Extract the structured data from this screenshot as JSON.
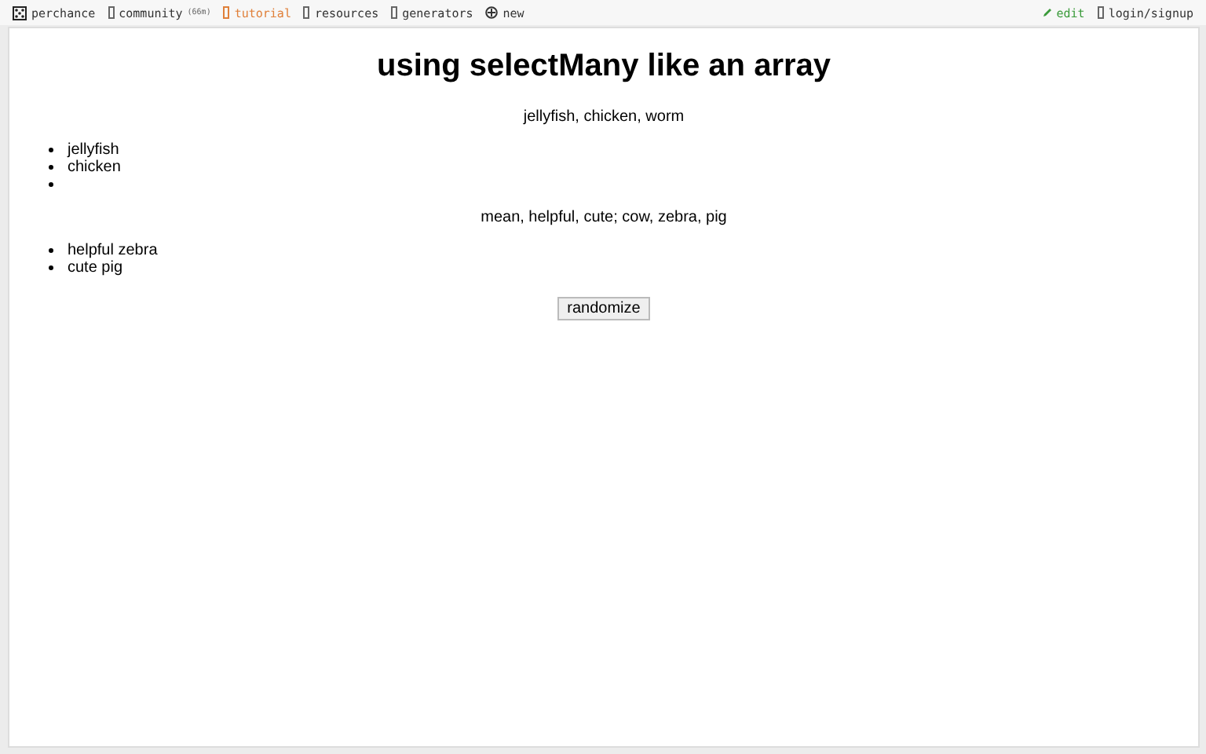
{
  "nav": {
    "items": [
      {
        "label": "perchance",
        "kind": "logo",
        "selected": false
      },
      {
        "label": "community",
        "kind": "link",
        "badge": "(66m)",
        "selected": false
      },
      {
        "label": "tutorial",
        "kind": "link",
        "selected": true
      },
      {
        "label": "resources",
        "kind": "link",
        "selected": false
      },
      {
        "label": "generators",
        "kind": "link",
        "selected": false
      },
      {
        "label": "new",
        "kind": "add",
        "selected": false
      }
    ],
    "right": [
      {
        "label": "edit",
        "kind": "edit"
      },
      {
        "label": "login/signup",
        "kind": "plain"
      }
    ]
  },
  "page": {
    "title": "using selectMany like an array",
    "sections": [
      {
        "line": "jellyfish, chicken, worm",
        "items": [
          {
            "kind": "text",
            "text": "jellyfish"
          },
          {
            "kind": "text",
            "text": "chicken"
          },
          {
            "kind": "empty"
          }
        ]
      },
      {
        "line": "mean, helpful, cute; cow, zebra, pig",
        "items": [
          {
            "kind": "text",
            "text": "helpful zebra"
          },
          {
            "kind": "text",
            "text": "cute pig"
          }
        ]
      }
    ],
    "button": "randomize"
  }
}
